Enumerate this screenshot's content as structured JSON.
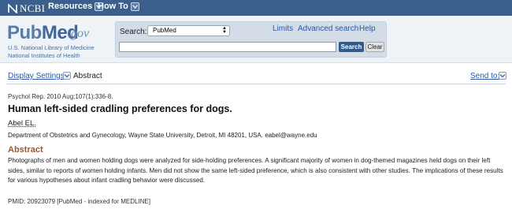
{
  "topbar": {
    "brand": "NCBI",
    "menus": [
      {
        "label": "Resources"
      },
      {
        "label": "How To"
      }
    ]
  },
  "header": {
    "logo": {
      "name_pub": "Pub",
      "name_med": "Med",
      "name_gov": ".gov",
      "sub_line1": "U.S. National Library of Medicine",
      "sub_line2": "National Institutes of Health"
    },
    "search": {
      "label": "Search:",
      "database": "PubMed",
      "query": "",
      "search_button": "Search",
      "clear_button": "Clear"
    },
    "links": [
      "Limits",
      "Advanced search",
      "Help"
    ]
  },
  "display": {
    "settings_label": "Display Settings:",
    "settings_value": "Abstract",
    "send_to": "Send to:"
  },
  "article": {
    "citation": "Psychol Rep. 2010 Aug;107(1):336-8.",
    "title": "Human left-sided cradling preferences for dogs.",
    "author": "Abel EL.",
    "affiliation": "Department of Obstetrics and Gynecology, Wayne State University, Detroit, MI 48201, USA. eabel@wayne.edu",
    "abstract_heading": "Abstract",
    "abstract_text": "Photographs of men and women holding dogs were analyzed for side-holding preferences. A significant majority of women in dog-themed magazines held dogs on their left sides, similar to reports of women holding infants. Men did not show the same left-sided preference, which is also consistent with other studies. The implications of these results for various hypotheses about infant cradling behavior were discussed.",
    "pmid": "PMID: 20923079 [PubMed - indexed for MEDLINE]"
  }
}
